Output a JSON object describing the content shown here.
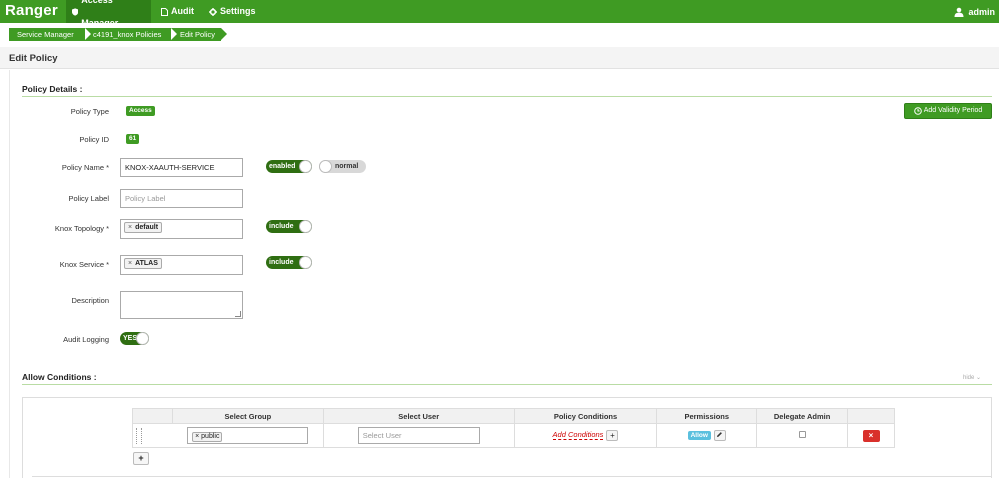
{
  "nav": {
    "brand": "Ranger",
    "items": [
      {
        "label": "Access Manager",
        "icon": "shield-icon",
        "active": true
      },
      {
        "label": "Audit",
        "icon": "file-icon",
        "active": false
      },
      {
        "label": "Settings",
        "icon": "gear-icon",
        "active": false
      }
    ],
    "user": "admin"
  },
  "breadcrumb": [
    "Service Manager",
    "c4191_knox Policies",
    "Edit Policy"
  ],
  "page": {
    "title": "Edit Policy"
  },
  "policy_details": {
    "section_title": "Policy Details :",
    "add_validity_label": "Add Validity Period",
    "policy_type_label": "Policy Type",
    "policy_type_value": "Access",
    "policy_id_label": "Policy ID",
    "policy_id_value": "61",
    "policy_name_label": "Policy Name *",
    "policy_name_value": "KNOX-XAAUTH-SERVICE",
    "enabled_toggle": "enabled",
    "normal_toggle": "normal",
    "policy_label_label": "Policy Label",
    "policy_label_placeholder": "Policy Label",
    "topology_label": "Knox Topology *",
    "topology_tag": "default",
    "topology_toggle": "include",
    "service_label": "Knox Service *",
    "service_tag": "ATLAS",
    "service_toggle": "include",
    "description_label": "Description",
    "audit_label": "Audit Logging",
    "audit_toggle": "YES"
  },
  "allow_conditions": {
    "section_title": "Allow Conditions :",
    "hide_label": "hide ⌄",
    "columns": [
      "Select Group",
      "Select User",
      "Policy Conditions",
      "Permissions",
      "Delegate Admin"
    ],
    "row": {
      "group_tag": "public",
      "user_placeholder": "Select User",
      "conditions_link": "Add Conditions",
      "permission": "Allow"
    }
  },
  "colors": {
    "brand": "#3f9b23",
    "brand_dark": "#2f7f18",
    "danger": "#d9302b",
    "info": "#5bc0de"
  }
}
